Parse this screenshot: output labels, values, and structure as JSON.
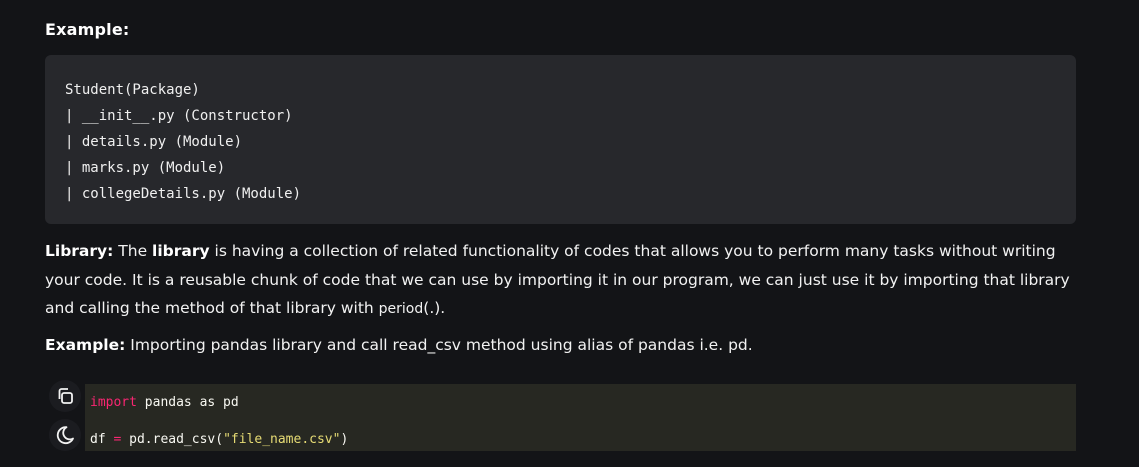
{
  "section1": {
    "heading": "Example:",
    "code_lines": [
      "Student(Package)",
      "| __init__.py (Constructor)",
      "| details.py (Module)",
      "| marks.py (Module)",
      "| collegeDetails.py (Module)"
    ]
  },
  "library": {
    "label": "Library:",
    "text_a": " The ",
    "bold_word": "library",
    "text_b": " is having a collection of related functionality of codes that allows you to perform many tasks without writing your code. It is a reusable chunk of code that we can use by importing it in our program, we can just use it by importing that library and calling the method of that library with ",
    "period_text": "period",
    "text_c": "(.)."
  },
  "example2": {
    "label": "Example:",
    "text": " Importing pandas library and call read_csv method using alias of pandas i.e. pd."
  },
  "code2": {
    "line1": {
      "keyword": "import",
      "rest": " pandas as pd"
    },
    "line2": {
      "var": "df ",
      "op": "=",
      "call": " pd.read_csv(",
      "string": "\"file_name.csv\"",
      "close": ")"
    }
  },
  "icons": {
    "copy": "copy-icon",
    "theme": "moon-icon"
  },
  "colors": {
    "background": "#131417",
    "code_block": "#27282c",
    "monokai_bg": "#272822",
    "keyword": "#f92672",
    "string": "#e6db74"
  }
}
